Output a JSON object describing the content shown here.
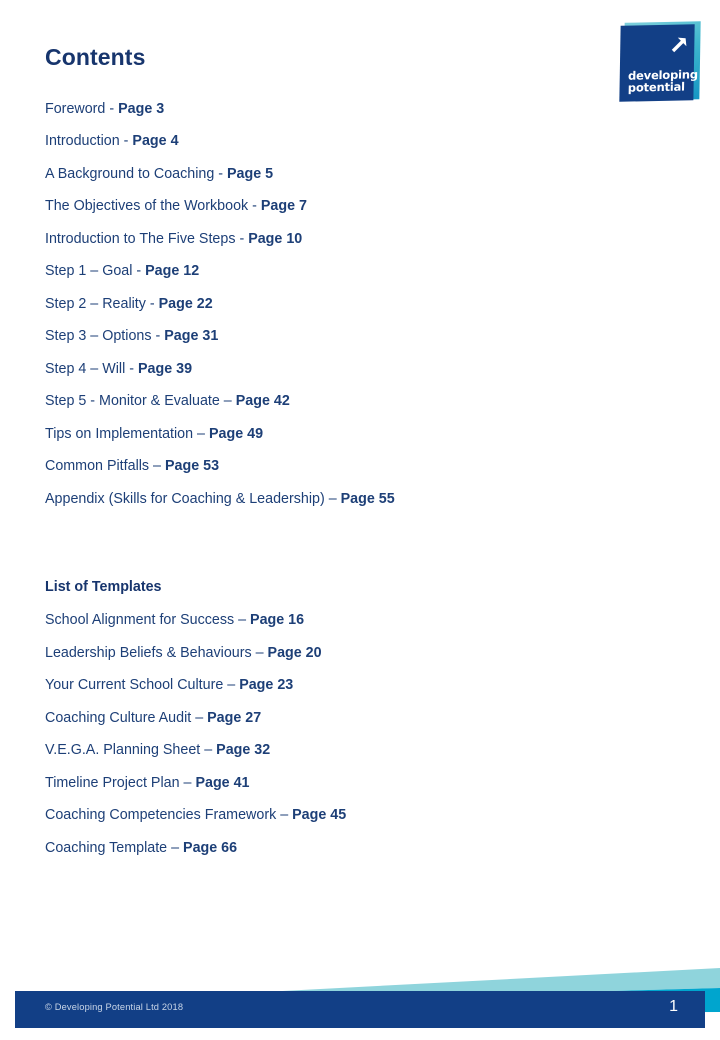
{
  "document": {
    "title": "Contents"
  },
  "logo": {
    "line1": "developing",
    "line2": "potential",
    "arrow_icon": "arrow-up-right-icon",
    "navy": "#123f86",
    "teal": "#3fb7cd"
  },
  "contents": {
    "heading": "Contents",
    "entries": [
      {
        "label": "Foreword  - ",
        "page": "Page 3"
      },
      {
        "label": "Introduction  - ",
        "page": "Page 4"
      },
      {
        "label": "A Background to Coaching - ",
        "page": "Page 5"
      },
      {
        "label": "The Objectives of the Workbook - ",
        "page": "Page 7"
      },
      {
        "label": "Introduction  to The Five Steps - ",
        "page": "Page 10"
      },
      {
        "label": "Step 1 – Goal - ",
        "page": "Page 12"
      },
      {
        "label": "Step 2 – Reality - ",
        "page": "Page 22"
      },
      {
        "label": "Step 3 – Options - ",
        "page": "Page 31"
      },
      {
        "label": "Step 4 – Will - ",
        "page": "Page 39"
      },
      {
        "label": "Step 5 - Monitor & Evaluate – ",
        "page": "Page 42"
      },
      {
        "label": "Tips on Implementation  – ",
        "page": "Page 49"
      },
      {
        "label": "Common Pitfalls – ",
        "page": "Page 53"
      },
      {
        "label": "Appendix (Skills for Coaching & Leadership) – ",
        "page": "Page 55"
      }
    ]
  },
  "templates": {
    "heading": "List of Templates",
    "entries": [
      {
        "label": "School Alignment for Success – ",
        "page": "Page 16"
      },
      {
        "label": "Leadership Beliefs & Behaviours  – ",
        "page": "Page 20"
      },
      {
        "label": "Your Current School Culture – ",
        "page": "Page 23"
      },
      {
        "label": "Coaching Culture Audit – ",
        "page": "Page 27"
      },
      {
        "label": "V.E.G.A. Planning Sheet – ",
        "page": "Page 32"
      },
      {
        "label": "Timeline Project Plan – ",
        "page": "Page 41"
      },
      {
        "label": "Coaching Competencies Framework – ",
        "page": "Page 45"
      },
      {
        "label": "Coaching Template  – ",
        "page": "Page 66"
      }
    ]
  },
  "footer": {
    "copyright": "© Developing Potential Ltd 2018",
    "page_number": "1",
    "band_light": "#8fd4dc",
    "band_cyan": "#00a5ce",
    "bar_navy": "#123f86"
  }
}
